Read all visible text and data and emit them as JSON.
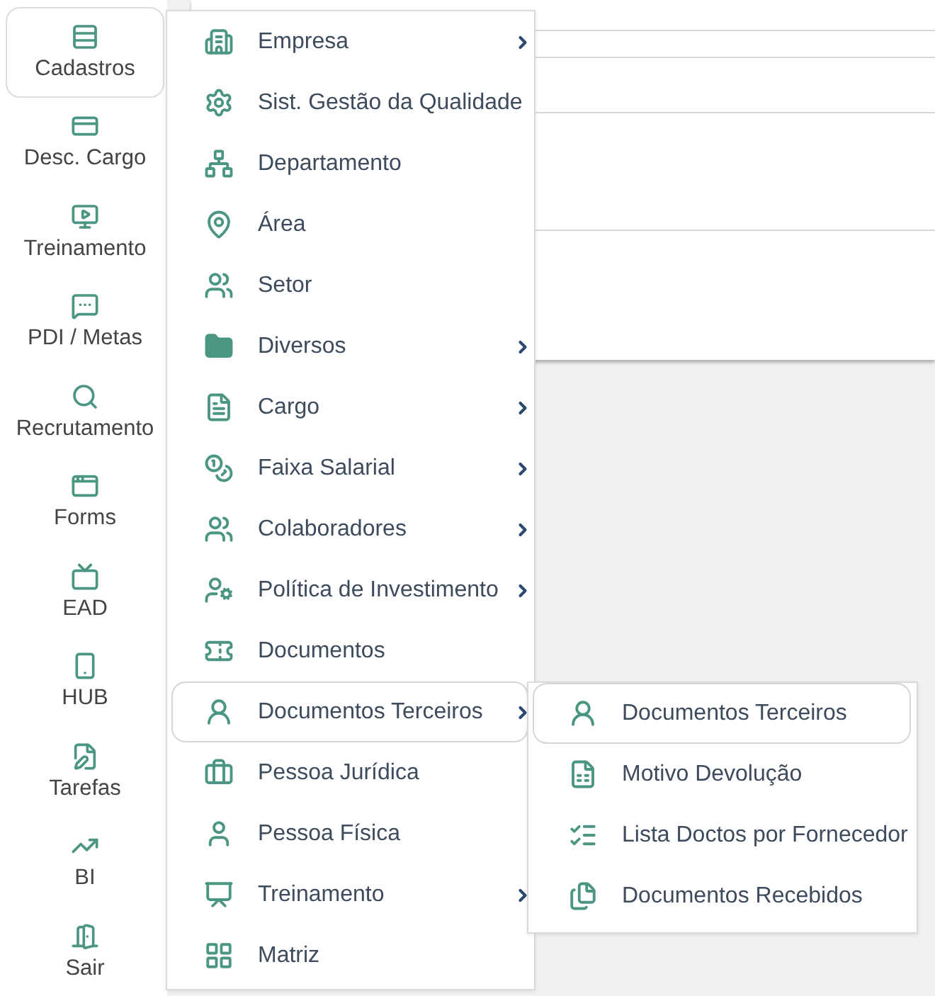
{
  "sidebar": {
    "items": [
      {
        "label": "Cadastros",
        "selected": true
      },
      {
        "label": "Desc. Cargo",
        "selected": false
      },
      {
        "label": "Treinamento",
        "selected": false
      },
      {
        "label": "PDI / Metas",
        "selected": false
      },
      {
        "label": "Recrutamento",
        "selected": false
      },
      {
        "label": "Forms",
        "selected": false
      },
      {
        "label": "EAD",
        "selected": false
      },
      {
        "label": "HUB",
        "selected": false
      },
      {
        "label": "Tarefas",
        "selected": false
      },
      {
        "label": "BI",
        "selected": false
      },
      {
        "label": "Sair",
        "selected": false
      }
    ]
  },
  "menu": {
    "items": [
      {
        "label": "Empresa",
        "has_submenu": true,
        "selected": false
      },
      {
        "label": "Sist. Gestão da Qualidade",
        "has_submenu": false,
        "selected": false
      },
      {
        "label": "Departamento",
        "has_submenu": false,
        "selected": false
      },
      {
        "label": "Área",
        "has_submenu": false,
        "selected": false
      },
      {
        "label": "Setor",
        "has_submenu": false,
        "selected": false
      },
      {
        "label": "Diversos",
        "has_submenu": true,
        "selected": false
      },
      {
        "label": "Cargo",
        "has_submenu": true,
        "selected": false
      },
      {
        "label": "Faixa Salarial",
        "has_submenu": true,
        "selected": false
      },
      {
        "label": "Colaboradores",
        "has_submenu": true,
        "selected": false
      },
      {
        "label": "Política de Investimento",
        "has_submenu": true,
        "selected": false
      },
      {
        "label": "Documentos",
        "has_submenu": false,
        "selected": false
      },
      {
        "label": "Documentos Terceiros",
        "has_submenu": true,
        "selected": true
      },
      {
        "label": "Pessoa Jurídica",
        "has_submenu": false,
        "selected": false
      },
      {
        "label": "Pessoa Física",
        "has_submenu": false,
        "selected": false
      },
      {
        "label": "Treinamento",
        "has_submenu": true,
        "selected": false
      },
      {
        "label": "Matriz",
        "has_submenu": false,
        "selected": false
      }
    ]
  },
  "submenu": {
    "items": [
      {
        "label": "Documentos Terceiros",
        "selected": true
      },
      {
        "label": "Motivo Devolução",
        "selected": false
      },
      {
        "label": "Lista Doctos por Fornecedor",
        "selected": false
      },
      {
        "label": "Documentos Recebidos",
        "selected": false
      }
    ]
  }
}
